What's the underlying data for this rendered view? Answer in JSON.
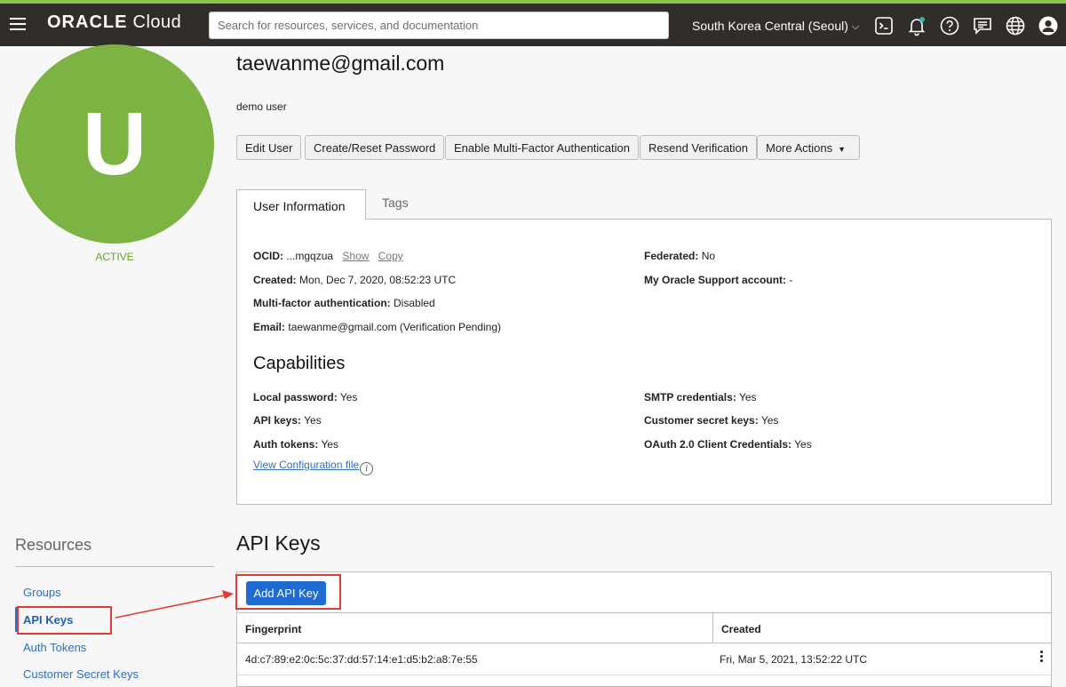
{
  "nav": {
    "logo_bold": "ORACLE",
    "logo_text": " Cloud",
    "search_placeholder": "Search for resources, services, and documentation",
    "region": "South Korea Central (Seoul)",
    "icons": [
      "cloud-shell-icon",
      "bell-icon",
      "help-icon",
      "chat-icon",
      "globe-icon",
      "user-profile-icon"
    ]
  },
  "user": {
    "avatar_letter": "U",
    "status": "ACTIVE",
    "name": "taewanme@gmail.com",
    "description": "demo user"
  },
  "actions": {
    "edit": "Edit User",
    "reset_password": "Create/Reset Password",
    "mfa": "Enable Multi-Factor Authentication",
    "resend": "Resend Verification",
    "more": "More Actions"
  },
  "tabs": {
    "info": "User Information",
    "tags": "Tags"
  },
  "info": {
    "ocid_label": "OCID:",
    "ocid_value": "...mgqzua",
    "show": "Show",
    "copy": "Copy",
    "created_label": "Created:",
    "created_value": "Mon, Dec 7, 2020, 08:52:23 UTC",
    "mfa_label": "Multi-factor authentication:",
    "mfa_value": "Disabled",
    "email_label": "Email:",
    "email_value": "taewanme@gmail.com (Verification Pending)",
    "federated_label": "Federated:",
    "federated_value": "No",
    "support_label": "My Oracle Support account:",
    "support_value": "-"
  },
  "capabilities": {
    "title": "Capabilities",
    "local_password_label": "Local password:",
    "local_password_value": "Yes",
    "api_keys_label": "API keys:",
    "api_keys_value": "Yes",
    "auth_tokens_label": "Auth tokens:",
    "auth_tokens_value": "Yes",
    "smtp_label": "SMTP credentials:",
    "smtp_value": "Yes",
    "customer_secret_label": "Customer secret keys:",
    "customer_secret_value": "Yes",
    "oauth_label": "OAuth 2.0 Client Credentials:",
    "oauth_value": "Yes",
    "config_link": "View Configuration file",
    "info_glyph": "i"
  },
  "resources": {
    "title": "Resources",
    "items": [
      "Groups",
      "API Keys",
      "Auth Tokens",
      "Customer Secret Keys"
    ]
  },
  "api_keys": {
    "title": "API Keys",
    "add_button": "Add API Key",
    "columns": [
      "Fingerprint",
      "Created"
    ],
    "rows": [
      {
        "fingerprint": "4d:c7:89:e2:0c:5c:37:dd:57:14:e1:d5:b2:a8:7e:55",
        "created": "Fri, Mar 5, 2021, 13:52:22 UTC"
      }
    ]
  },
  "colors": {
    "accent": "#1f6bd1",
    "avatar": "#7cb342",
    "status_active": "#6aa22e",
    "annotation": "#e53935"
  }
}
